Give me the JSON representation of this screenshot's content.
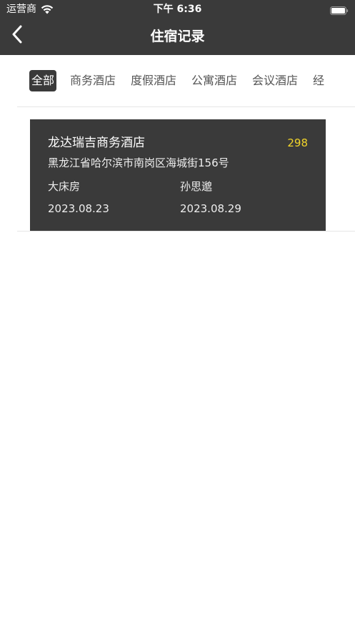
{
  "status_bar": {
    "carrier": "运营商",
    "time": "下午 6:36"
  },
  "nav": {
    "title": "住宿记录"
  },
  "tabs": [
    {
      "label": "全部",
      "active": true
    },
    {
      "label": "商务酒店",
      "active": false
    },
    {
      "label": "度假酒店",
      "active": false
    },
    {
      "label": "公寓酒店",
      "active": false
    },
    {
      "label": "会议酒店",
      "active": false
    },
    {
      "label": "经",
      "active": false
    }
  ],
  "records": [
    {
      "hotel_name": "龙达瑞吉商务酒店",
      "price": "298",
      "address": "黑龙江省哈尔滨市南岗区海城街156号",
      "room_type": "大床房",
      "guest": "孙思邈",
      "check_in": "2023.08.23",
      "check_out": "2023.08.29"
    }
  ],
  "colors": {
    "header_bg": "#3a3a3a",
    "card_bg": "#3a3a3a",
    "price": "#f2d52a",
    "active_tab_bg": "#3a3a3a"
  },
  "icons": {
    "back": "chevron-left-icon",
    "wifi": "wifi-icon",
    "battery": "battery-icon"
  }
}
